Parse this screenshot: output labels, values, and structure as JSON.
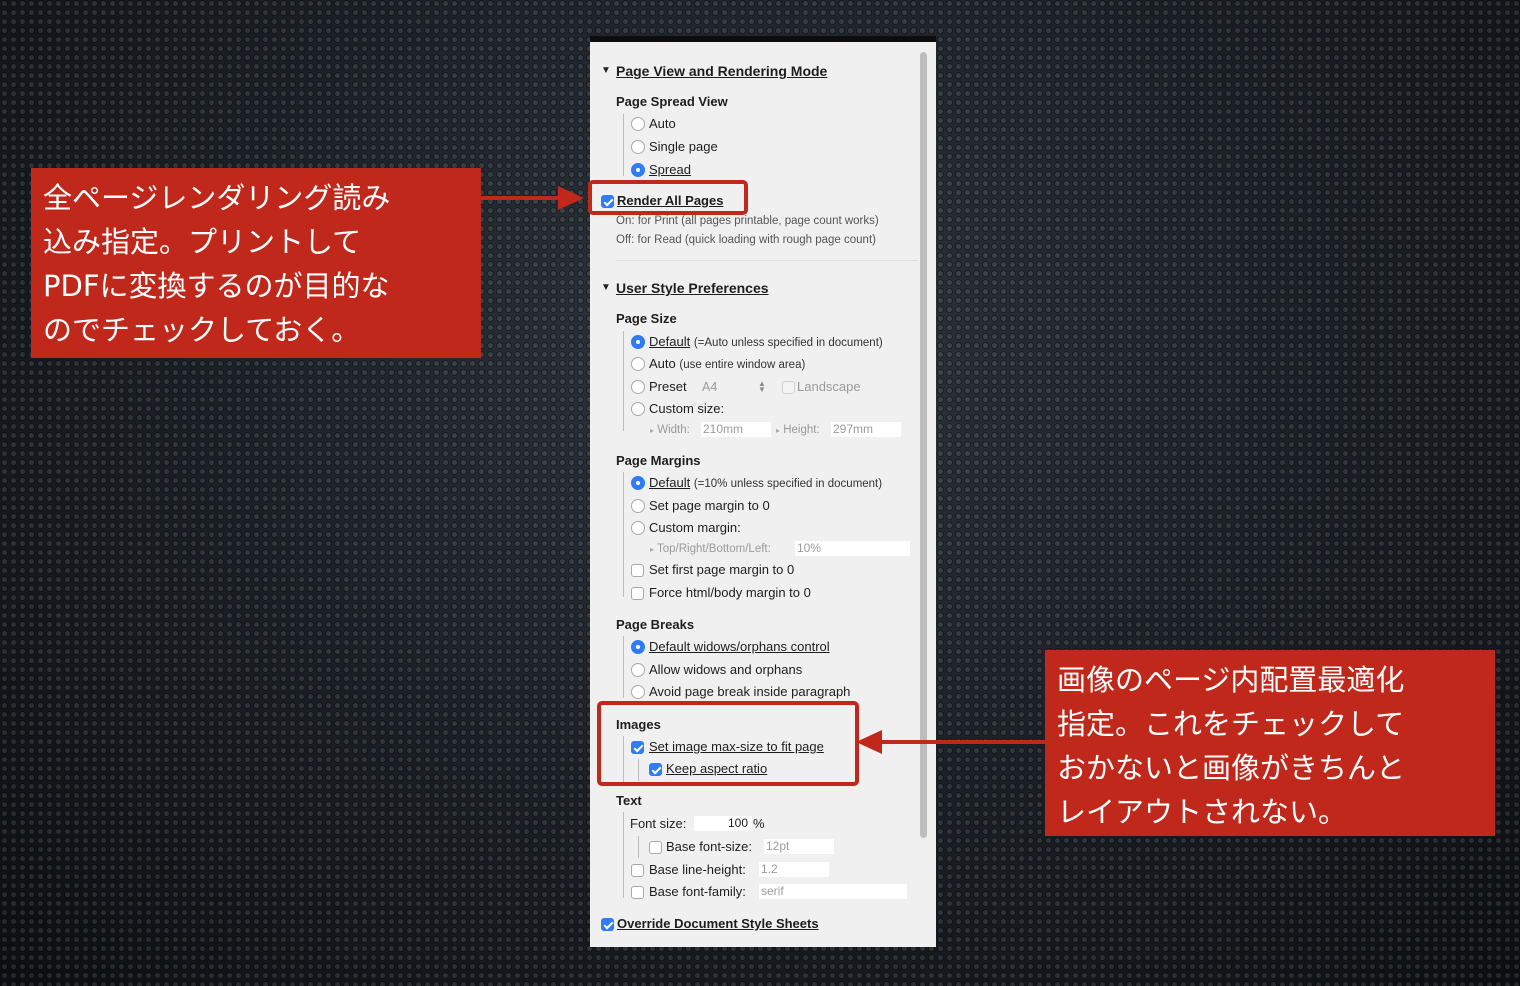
{
  "panel": {
    "section_page_view": {
      "title": "Page View and Rendering Mode",
      "spread_view": {
        "heading": "Page Spread View",
        "options": [
          "Auto",
          "Single page",
          "Spread"
        ],
        "selected": "Spread"
      },
      "render_all_pages": {
        "label": "Render All Pages",
        "checked": true,
        "hint_on": "On: for Print (all pages printable, page count works)",
        "hint_off": "Off: for Read (quick loading with rough page count)"
      }
    },
    "section_user_style": {
      "title": "User Style Preferences",
      "page_size": {
        "heading": "Page Size",
        "default_label": "Default",
        "default_note": "(=Auto unless specified in document)",
        "auto_label": "Auto",
        "auto_note": "(use entire window area)",
        "preset_label": "Preset",
        "preset_value": "A4",
        "landscape_label": "Landscape",
        "custom_label": "Custom size:",
        "width_label": "Width:",
        "width_value": "210mm",
        "height_label": "Height:",
        "height_value": "297mm"
      },
      "page_margins": {
        "heading": "Page Margins",
        "default_label": "Default",
        "default_note": "(=10% unless specified in document)",
        "zero_label": "Set page margin to 0",
        "custom_label": "Custom margin:",
        "trbl_label": "Top/Right/Bottom/Left:",
        "trbl_value": "10%",
        "first_page_label": "Set first page margin to 0",
        "force_label": "Force html/body margin to 0"
      },
      "page_breaks": {
        "heading": "Page Breaks",
        "options": [
          "Default widows/orphans control",
          "Allow widows and orphans",
          "Avoid page break inside paragraph"
        ],
        "selected": "Default widows/orphans control"
      },
      "images": {
        "heading": "Images",
        "fit_label": "Set image max-size to fit page",
        "fit_checked": true,
        "aspect_label": "Keep aspect ratio",
        "aspect_checked": true
      },
      "text": {
        "heading": "Text",
        "font_size_label": "Font size:",
        "font_size_value": "100",
        "font_size_unit": "%",
        "base_font_size_label": "Base font-size:",
        "base_font_size_value": "12pt",
        "line_height_label": "Base line-height:",
        "line_height_value": "1.2",
        "font_family_label": "Base font-family:",
        "font_family_value": "serif"
      }
    },
    "override_label": "Override Document Style Sheets",
    "override_checked": true
  },
  "annotations": {
    "render": "全ページレンダリング読み\n込み指定。プリントして\nPDFに変換するのが目的な\nのでチェックしておく。",
    "images": "画像のページ内配置最適化\n指定。これをチェックして\nおかないと画像がきちんと\nレイアウトされない。"
  },
  "colors": {
    "accent": "#2f7cf6",
    "annotation": "#c0281b",
    "panel_bg": "#f0f0f0"
  }
}
